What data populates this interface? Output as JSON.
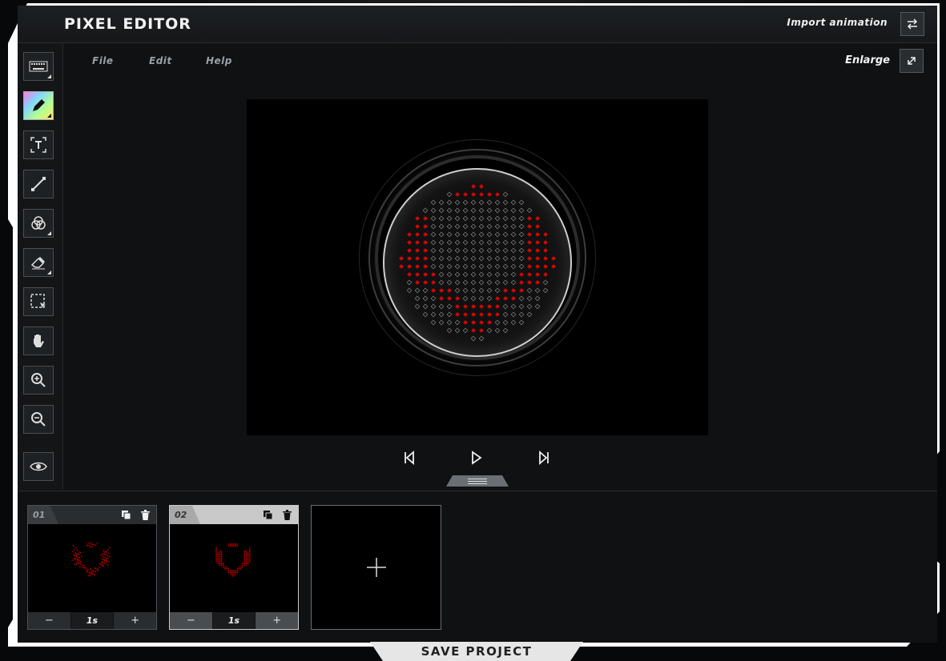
{
  "app": {
    "title": "PIXEL EDITOR"
  },
  "header": {
    "import_label": "Import animation",
    "import_icon": "swap-icon"
  },
  "menu": {
    "items": [
      {
        "label": "File"
      },
      {
        "label": "Edit"
      },
      {
        "label": "Help"
      }
    ]
  },
  "view": {
    "enlarge_label": "Enlarge",
    "enlarge_icon": "expand-icon"
  },
  "tools": [
    {
      "name": "keyboard-tool",
      "icon": "keyboard-icon"
    },
    {
      "name": "pencil-tool",
      "icon": "pencil-icon",
      "active": true
    },
    {
      "name": "text-tool",
      "icon": "text-icon"
    },
    {
      "name": "line-tool",
      "icon": "line-icon"
    },
    {
      "name": "color-fill-tool",
      "icon": "color-mix-icon"
    },
    {
      "name": "eraser-tool",
      "icon": "eraser-icon"
    },
    {
      "name": "select-tool",
      "icon": "selection-icon"
    },
    {
      "name": "hand-tool",
      "icon": "hand-icon"
    },
    {
      "name": "zoom-in-tool",
      "icon": "zoom-in-icon"
    },
    {
      "name": "zoom-out-tool",
      "icon": "zoom-out-icon"
    },
    {
      "name": "preview-tool",
      "icon": "eye-icon"
    }
  ],
  "colors": {
    "pixel_on": "#e00000",
    "pixel_off": "#777777",
    "accent": "#ffffff"
  },
  "playback": {
    "prev_icon": "skip-back-icon",
    "play_icon": "play-icon",
    "next_icon": "skip-forward-icon"
  },
  "frames": [
    {
      "number": "01",
      "duration": "1s",
      "minus": "−",
      "plus": "+"
    },
    {
      "number": "02",
      "duration": "1s",
      "minus": "−",
      "plus": "+",
      "selected": true
    }
  ],
  "add_frame": {
    "icon": "plus-icon"
  },
  "save": {
    "label": "SAVE PROJECT"
  }
}
